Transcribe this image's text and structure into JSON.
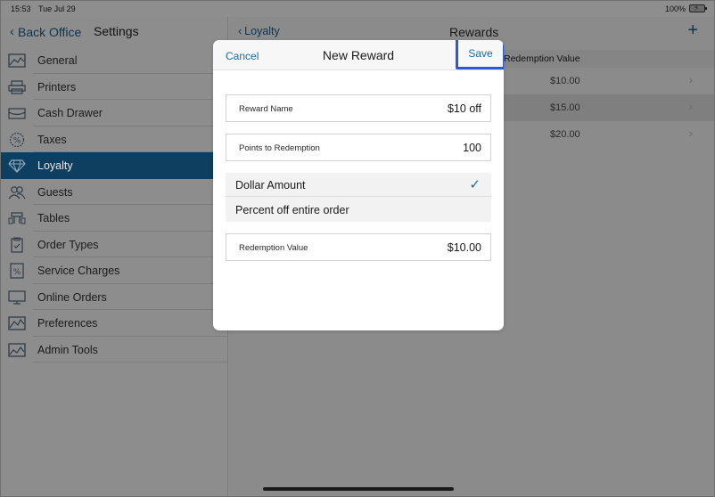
{
  "status_bar": {
    "time": "15:53",
    "date": "Tue Jul 29",
    "battery_percent": "100%"
  },
  "sidebar": {
    "back_label": "Back Office",
    "title": "Settings",
    "items": [
      {
        "label": "General",
        "icon": "general-icon"
      },
      {
        "label": "Printers",
        "icon": "printer-icon"
      },
      {
        "label": "Cash Drawer",
        "icon": "cash-drawer-icon"
      },
      {
        "label": "Taxes",
        "icon": "taxes-icon"
      },
      {
        "label": "Loyalty",
        "icon": "diamond-icon",
        "active": true
      },
      {
        "label": "Guests",
        "icon": "guests-icon"
      },
      {
        "label": "Tables",
        "icon": "tables-icon"
      },
      {
        "label": "Order Types",
        "icon": "clipboard-icon"
      },
      {
        "label": "Service Charges",
        "icon": "percent-icon"
      },
      {
        "label": "Online Orders",
        "icon": "monitor-icon"
      },
      {
        "label": "Preferences",
        "icon": "preferences-icon"
      },
      {
        "label": "Admin Tools",
        "icon": "admin-tools-icon"
      }
    ]
  },
  "detail": {
    "back_label": "Loyalty",
    "title": "Rewards",
    "add_symbol": "+",
    "column_header": "Redemption Value",
    "rows": [
      {
        "value": "$10.00"
      },
      {
        "value": "$15.00"
      },
      {
        "value": "$20.00"
      }
    ]
  },
  "modal": {
    "cancel_label": "Cancel",
    "title": "New Reward",
    "save_label": "Save",
    "reward_name": {
      "label": "Reward Name",
      "value": "$10 off"
    },
    "points": {
      "label": "Points to Redemption",
      "value": "100"
    },
    "options": [
      {
        "label": "Dollar Amount",
        "selected": true
      },
      {
        "label": "Percent off entire order",
        "selected": false
      }
    ],
    "check_mark": "✓",
    "redemption_value": {
      "label": "Redemption Value",
      "value": "$10.00"
    }
  },
  "colors": {
    "accent": "#1f6aa5",
    "active_sidebar": "#0f3f60",
    "highlight_box": "#2a5bd7"
  }
}
